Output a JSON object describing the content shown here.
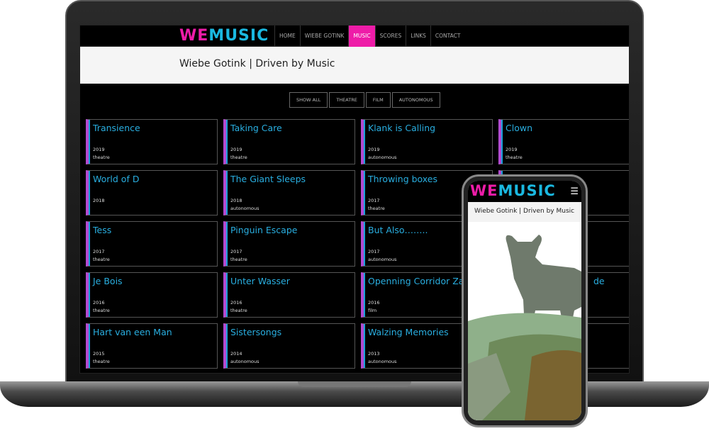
{
  "site": {
    "logo": "WEMUSIC",
    "logo_we": "WE",
    "logo_music": "MUSIC",
    "title": "Wiebe Gotink | Driven by Music"
  },
  "nav": [
    "HOME",
    "WIEBE GOTINK",
    "MUSIC",
    "SCORES",
    "LINKS",
    "CONTACT"
  ],
  "active_nav": "MUSIC",
  "filters": [
    "SHOW ALL",
    "THEATRE",
    "FILM",
    "AUTONOMOUS"
  ],
  "cards": [
    {
      "title": "Transience",
      "year": "2019",
      "category": "theatre"
    },
    {
      "title": "Taking Care",
      "year": "2019",
      "category": "theatre"
    },
    {
      "title": "Klank is Calling",
      "year": "2019",
      "category": "autonomous"
    },
    {
      "title": "Clown",
      "year": "2019",
      "category": "theatre"
    },
    {
      "title": "World of D",
      "year": "2018",
      "category": ""
    },
    {
      "title": "The Giant Sleeps",
      "year": "2018",
      "category": "autonomous"
    },
    {
      "title": "Throwing boxes",
      "year": "2017",
      "category": "theatre"
    },
    {
      "title": "",
      "year": "",
      "category": ""
    },
    {
      "title": "Tess",
      "year": "2017",
      "category": "theatre"
    },
    {
      "title": "Pinguin Escape",
      "year": "2017",
      "category": "theatre"
    },
    {
      "title": "But Also……..",
      "year": "2017",
      "category": "autonomous"
    },
    {
      "title": "",
      "year": "",
      "category": ""
    },
    {
      "title": "Je Bois",
      "year": "2016",
      "category": "theatre"
    },
    {
      "title": "Unter Wasser",
      "year": "2016",
      "category": "theatre"
    },
    {
      "title": "Openning Corridor Zaven",
      "year": "2016",
      "category": "film"
    },
    {
      "title": "de",
      "year": "",
      "category": ""
    },
    {
      "title": "Hart van een Man",
      "year": "2015",
      "category": "theatre"
    },
    {
      "title": "Sistersongs",
      "year": "2014",
      "category": "autonomous"
    },
    {
      "title": "Walzing Memories",
      "year": "2013",
      "category": "autonomous"
    },
    {
      "title": "",
      "year": "",
      "category": ""
    }
  ],
  "colors": {
    "accent_pink": "#ee1ca8",
    "accent_blue": "#1ab8e0"
  },
  "mobile": {
    "menu_icon": "hamburger-icon"
  }
}
